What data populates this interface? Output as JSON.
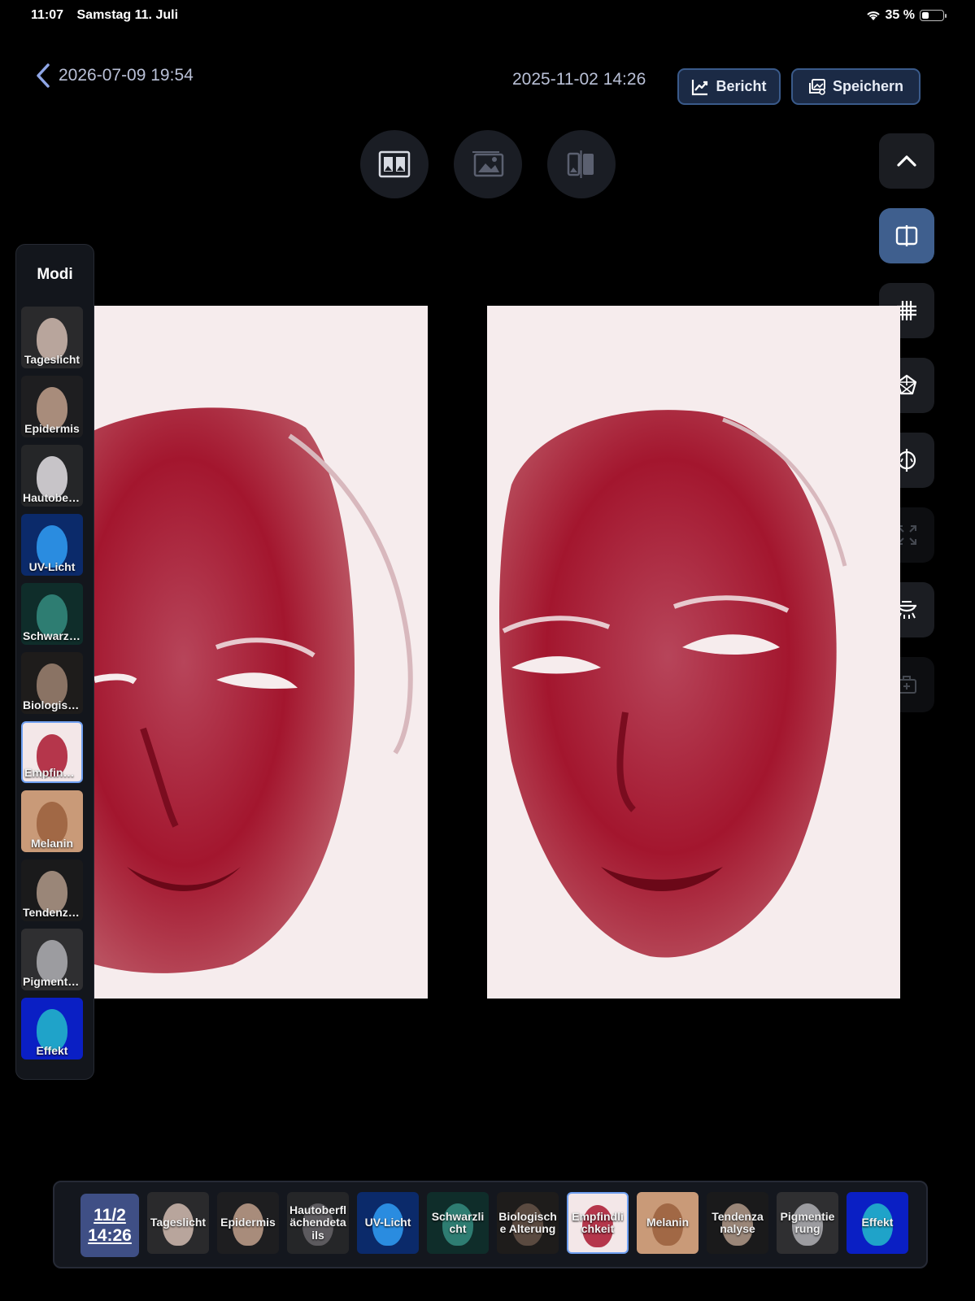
{
  "status_bar": {
    "time": "11:07",
    "date": "Samstag 11. Juli",
    "battery": "35 %"
  },
  "header": {
    "left_date": "2026-07-09 19:54",
    "right_date": "2025-11-02 14:26",
    "report_label": "Bericht",
    "save_label": "Speichern"
  },
  "modes_panel": {
    "title": "Modi",
    "items": [
      {
        "label": "Tageslicht"
      },
      {
        "label": "Epidermis"
      },
      {
        "label": "Hautoberflächendetails"
      },
      {
        "label": "UV-Licht"
      },
      {
        "label": "Schwarzlicht"
      },
      {
        "label": "Biologische Alterung"
      },
      {
        "label": "Empfindlichkeit",
        "active": true
      },
      {
        "label": "Melanin"
      },
      {
        "label": "Tendenzanalyse"
      },
      {
        "label": "Pigmentierung"
      },
      {
        "label": "Effekt"
      }
    ]
  },
  "bottom_strip": {
    "date_tile": {
      "line1": "11/2",
      "line2": "14:26"
    },
    "items": [
      {
        "label": "Tageslicht"
      },
      {
        "label": "Epidermis"
      },
      {
        "label": "Hautoberflächendetails"
      },
      {
        "label": "UV-Licht"
      },
      {
        "label": "Schwarzlicht"
      },
      {
        "label": "Biologische Alterung"
      },
      {
        "label": "Empfindlichkeit",
        "active": true
      },
      {
        "label": "Melanin"
      },
      {
        "label": "Tendenzanalyse"
      },
      {
        "label": "Pigmentierung"
      },
      {
        "label": "Effekt"
      }
    ]
  },
  "right_toolbar": [
    {
      "icon": "chevron-up-icon"
    },
    {
      "icon": "split-view-icon",
      "active": true
    },
    {
      "icon": "grid-icon"
    },
    {
      "icon": "face-mesh-icon"
    },
    {
      "icon": "symmetry-icon"
    },
    {
      "icon": "expand-icon",
      "disabled": true
    },
    {
      "icon": "lamp-icon"
    },
    {
      "icon": "toolkit-icon",
      "disabled": true
    }
  ],
  "colors": {
    "accent": "#3f5f8e",
    "sensitivity_red": "#a3162e",
    "background": "#000000"
  }
}
